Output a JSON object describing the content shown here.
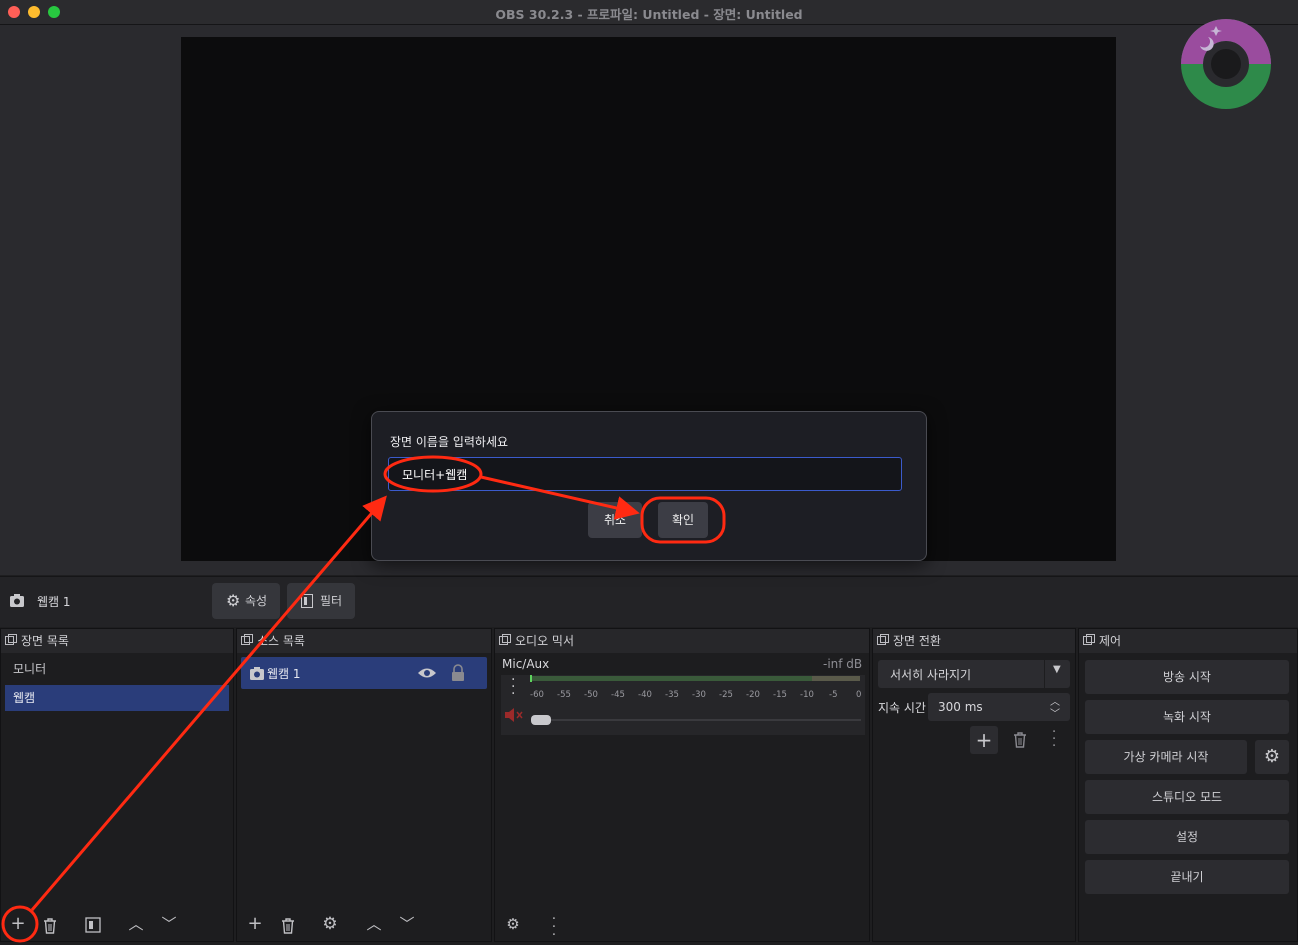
{
  "window": {
    "title": "OBS 30.2.3 - 프로파일: Untitled - 장면: Untitled"
  },
  "dialog": {
    "label": "장면 이름을 입력하세요",
    "input_value": "모니터+웹캠",
    "cancel_label": "취소",
    "ok_label": "확인"
  },
  "source_bar": {
    "selected_source": "웹캠 1",
    "properties_label": "속성",
    "filters_label": "필터"
  },
  "scenes": {
    "title": "장면 목록",
    "items": [
      "모니터",
      "웹캠"
    ],
    "selected_index": 1
  },
  "sources": {
    "title": "소스 목록",
    "items": [
      "웹캠 1"
    ]
  },
  "mixer": {
    "title": "오디오 믹서",
    "channel_name": "Mic/Aux",
    "level": "-inf dB",
    "ticks": [
      "-60",
      "-55",
      "-50",
      "-45",
      "-40",
      "-35",
      "-30",
      "-25",
      "-20",
      "-15",
      "-10",
      "-5",
      "0"
    ]
  },
  "transitions": {
    "title": "장면 전환",
    "selected": "서서히 사라지기",
    "duration_label": "지속 시간",
    "duration_value": "300 ms"
  },
  "controls": {
    "title": "제어",
    "buttons": [
      "방송 시작",
      "녹화 시작",
      "가상 카메라 시작",
      "스튜디오 모드",
      "설정",
      "끝내기"
    ]
  },
  "colors": {
    "annotation": "#ff2a12",
    "selection": "#2a3d7a",
    "traffic_red": "#ff5f57",
    "traffic_yellow": "#febc2e",
    "traffic_green": "#28c840"
  }
}
